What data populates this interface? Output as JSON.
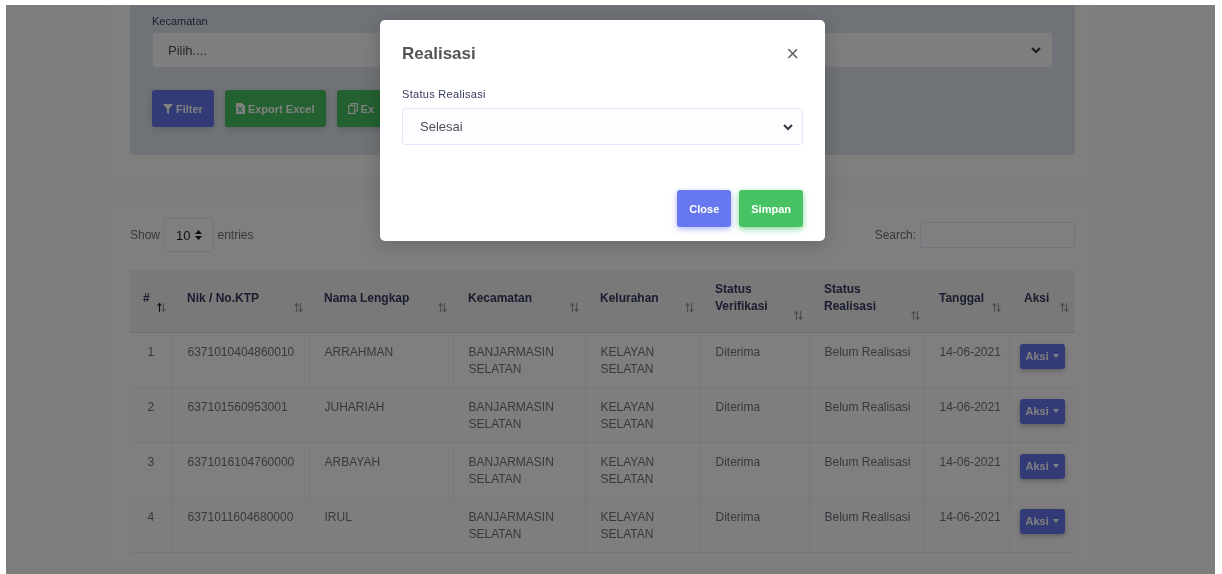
{
  "filter_panel": {
    "field": {
      "label": "Kecamatan",
      "value": "Pilih...."
    },
    "buttons": [
      {
        "label": "Filter",
        "kind": "filter"
      },
      {
        "label": "Export Excel",
        "kind": "excel"
      },
      {
        "label": "Ex",
        "kind": "copy"
      }
    ]
  },
  "table_card": {
    "length_label": "Show",
    "length_value": "10",
    "length_suffix": "entries",
    "search_label": "Search:",
    "columns": [
      {
        "label": "#",
        "sorted_ascending": true
      },
      {
        "label": "Nik / No.KTP",
        "sorted_ascending": false
      },
      {
        "label": "Nama Lengkap",
        "sorted_ascending": false
      },
      {
        "label": "Kecamatan",
        "sorted_ascending": false
      },
      {
        "label": "Kelurahan",
        "sorted_ascending": false
      },
      {
        "label": "Status Verifikasi",
        "sorted_ascending": false
      },
      {
        "label": "Status Realisasi",
        "sorted_ascending": false
      },
      {
        "label": "Tanggal",
        "sorted_ascending": false
      },
      {
        "label": "Aksi",
        "sorted_ascending": false
      }
    ],
    "rows": [
      [
        "1",
        "6371010404860010",
        "ARRAHMAN",
        "BANJARMASIN SELATAN",
        "KELAYAN SELATAN",
        "Diterima",
        "Belum Realisasi",
        "14-06-2021",
        "Aksi"
      ],
      [
        "2",
        "637101560953001",
        "JUHARIAH",
        "BANJARMASIN SELATAN",
        "KELAYAN SELATAN",
        "Diterima",
        "Belum Realisasi",
        "14-06-2021",
        "Aksi"
      ],
      [
        "3",
        "6371016104760000",
        "ARBAYAH",
        "BANJARMASIN SELATAN",
        "KELAYAN SELATAN",
        "Diterima",
        "Belum Realisasi",
        "14-06-2021",
        "Aksi"
      ],
      [
        "4",
        "6371011604680000",
        "IRUL",
        "BANJARMASIN SELATAN",
        "KELAYAN SELATAN",
        "Diterima",
        "Belum Realisasi",
        "14-06-2021",
        "Aksi"
      ]
    ]
  },
  "modal": {
    "title": "Realisasi",
    "close_symbol": "×",
    "field_label": "Status Realisasi",
    "field_value": "Selesai",
    "buttons": [
      {
        "label": "Close",
        "kind": "secondary"
      },
      {
        "label": "Simpan",
        "kind": "primary"
      }
    ]
  }
}
